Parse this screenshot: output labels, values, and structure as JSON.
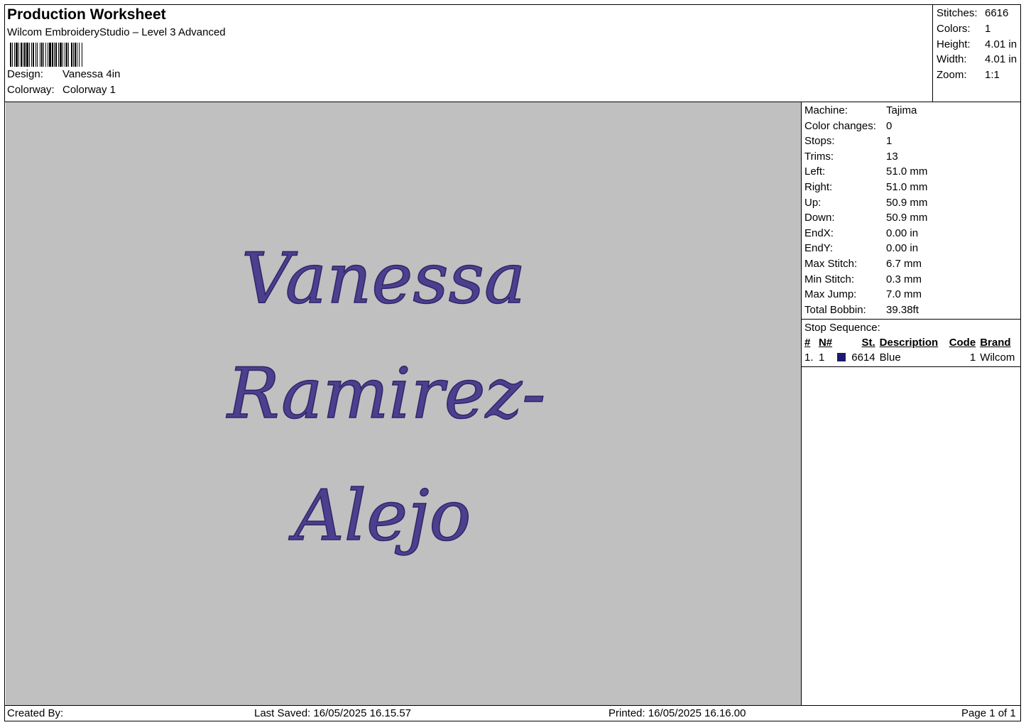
{
  "header": {
    "title": "Production Worksheet",
    "subtitle": "Wilcom EmbroideryStudio – Level 3 Advanced",
    "design_label": "Design:",
    "design_value": "Vanessa 4in",
    "colorway_label": "Colorway:",
    "colorway_value": "Colorway 1"
  },
  "summary": {
    "stitches_label": "Stitches:",
    "stitches_value": "6616",
    "colors_label": "Colors:",
    "colors_value": "1",
    "height_label": "Height:",
    "height_value": "4.01 in",
    "width_label": "Width:",
    "width_value": "4.01 in",
    "zoom_label": "Zoom:",
    "zoom_value": "1:1"
  },
  "design_text": {
    "line1": "Vanessa",
    "line2": "Ramirez-",
    "line3": "Alejo",
    "thread_color": "#4b3f8e",
    "background_color": "#c0c0c0"
  },
  "machine_info": [
    {
      "label": "Machine:",
      "value": "Tajima"
    },
    {
      "label": "Color changes:",
      "value": "0"
    },
    {
      "label": "Stops:",
      "value": "1"
    },
    {
      "label": "Trims:",
      "value": "13"
    },
    {
      "label": "Left:",
      "value": "51.0 mm"
    },
    {
      "label": "Right:",
      "value": "51.0 mm"
    },
    {
      "label": "Up:",
      "value": "50.9 mm"
    },
    {
      "label": "Down:",
      "value": "50.9 mm"
    },
    {
      "label": "EndX:",
      "value": "0.00 in"
    },
    {
      "label": "EndY:",
      "value": "0.00 in"
    },
    {
      "label": "Max Stitch:",
      "value": "6.7 mm"
    },
    {
      "label": "Min Stitch:",
      "value": "0.3 mm"
    },
    {
      "label": "Max Jump:",
      "value": "7.0 mm"
    },
    {
      "label": "Total Bobbin:",
      "value": "39.38ft"
    }
  ],
  "stop_sequence": {
    "title": "Stop Sequence:",
    "headers": {
      "hash": "#",
      "n": "N#",
      "st": "St.",
      "description": "Description",
      "code": "Code",
      "brand": "Brand"
    },
    "rows": [
      {
        "hash": "1.",
        "n": "1",
        "swatch_color": "#1f1a6e",
        "st": "6614",
        "description": "Blue",
        "code": "1",
        "brand": "Wilcom"
      }
    ]
  },
  "footer": {
    "created_by": "Created By:",
    "last_saved": "Last Saved: 16/05/2025 16.15.57",
    "printed": "Printed: 16/05/2025 16.16.00",
    "page": "Page 1 of 1"
  }
}
